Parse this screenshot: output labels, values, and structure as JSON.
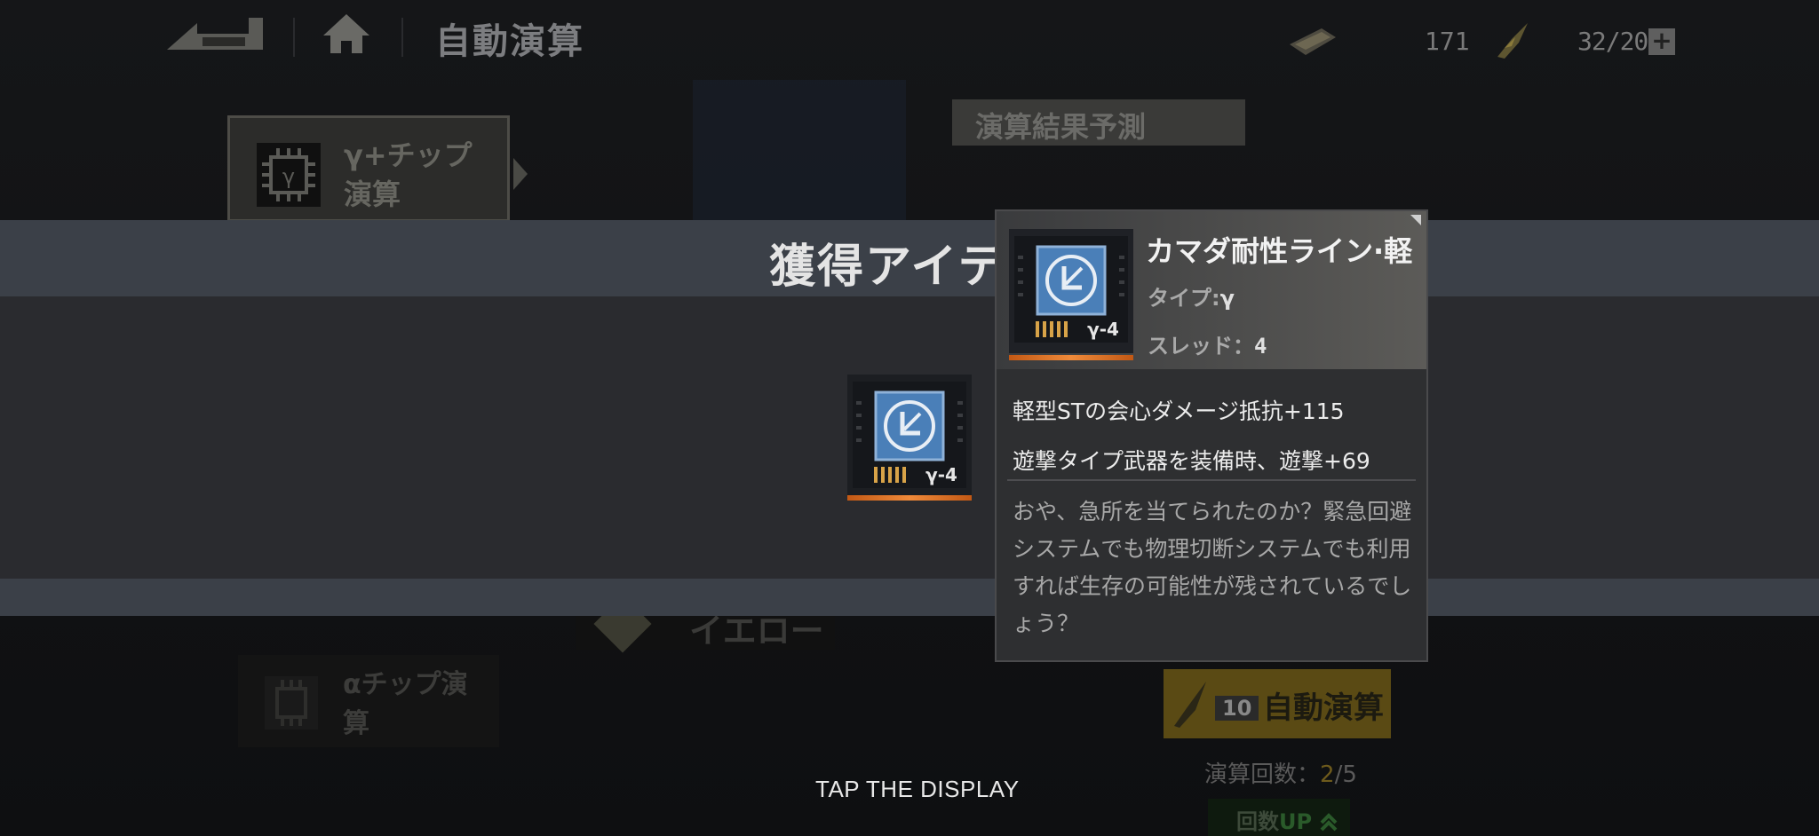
{
  "header": {
    "title": "自動演算",
    "resource1_value": "171",
    "resource2_value": "32/200",
    "plus_label": "+"
  },
  "side_menu": {
    "gamma_label": "γ+チップ演算",
    "alpha_label": "αチップ演算"
  },
  "prediction": {
    "label": "演算結果予測",
    "yellow_tag": "イエロー"
  },
  "auto_calc": {
    "count_badge": "10",
    "label": "自動演算",
    "count_prefix": "演算回数：",
    "count_current": "2",
    "count_total": "/5",
    "up_prefix": "回数",
    "up_suffix": "UP"
  },
  "acquired": {
    "title": "獲得アイテ",
    "item_code": "γ-4"
  },
  "tooltip": {
    "name": "カマダ耐性ライン·軽",
    "type_label": "タイプ:",
    "type_value": "γ",
    "thread_label": "スレッド：",
    "thread_value": "4",
    "effect1": "軽型STの会心ダメージ抵抗+115",
    "effect2": "遊撃タイプ武器を装備時、遊撃+69",
    "description": "おや、急所を当てられたのか？緊急回避システムでも物理切断システムでも利用すれば生存の可能性が残されているでしょう？",
    "item_code": "γ-4"
  },
  "footer": {
    "tap_label": "TAP THE DISPLAY"
  },
  "colors": {
    "accent_orange": "#f08a3a",
    "band": "#3b4048",
    "chip_blue": "#4a7fb8"
  },
  "icons": [
    "back-arrow-icon",
    "home-icon",
    "ammo-resource-icon",
    "energy-resource-icon",
    "chip-icon",
    "sword-icon",
    "chevron-up-icon"
  ]
}
